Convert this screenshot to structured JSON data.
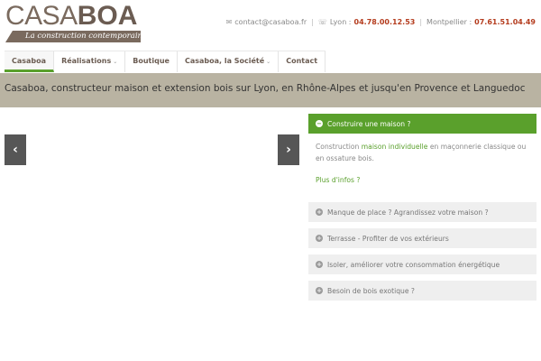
{
  "logo": {
    "casa": "CASA",
    "boa": "BOA",
    "tagline": "La construction contemporaine"
  },
  "contact": {
    "email": "contact@casaboa.fr",
    "lyon_label": "Lyon :",
    "lyon_phone": "04.78.00.12.53",
    "montpellier_label": "Montpellier :",
    "montpellier_phone": "07.61.51.04.49",
    "mail_icon": "envelope-icon",
    "phone_icon": "phone-icon"
  },
  "nav": {
    "items": [
      {
        "label": "Casaboa",
        "active": true,
        "dropdown": false
      },
      {
        "label": "Réalisations",
        "active": false,
        "dropdown": true
      },
      {
        "label": "Boutique",
        "active": false,
        "dropdown": false
      },
      {
        "label": "Casaboa, la Société",
        "active": false,
        "dropdown": true
      },
      {
        "label": "Contact",
        "active": false,
        "dropdown": false
      }
    ]
  },
  "banner": {
    "title": "Casaboa, constructeur maison et extension bois sur Lyon, en Rhône-Alpes et jusqu'en Provence et Languedoc"
  },
  "slider": {
    "prev_icon": "chevron-left-icon",
    "next_icon": "chevron-right-icon"
  },
  "accordion": {
    "open": {
      "title": "Construire une maison ?",
      "body_prefix": "Construction ",
      "body_link": "maison individuelle",
      "body_suffix": " en maçonnerie classique ou en ossature bois.",
      "more": "Plus d'infos ?"
    },
    "closed": [
      {
        "title": "Manque de place ? Agrandissez votre maison ?"
      },
      {
        "title": "Terrasse - Profiter de vos extérieurs"
      },
      {
        "title": "Isoler, améliorer votre consommation énergétique"
      },
      {
        "title": "Besoin de bois exotique ?"
      }
    ]
  },
  "colors": {
    "accent_green": "#5aa02c",
    "brand_brown": "#7a6a5e",
    "banner_bg": "#b9b3a2",
    "phone_red": "#b43c1e"
  }
}
